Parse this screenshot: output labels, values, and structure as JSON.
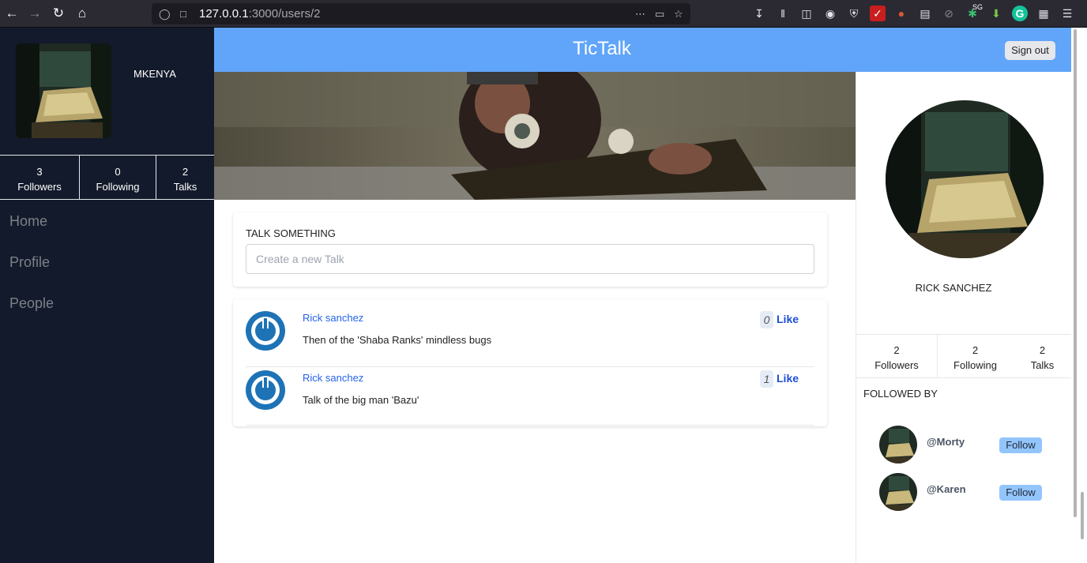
{
  "browser": {
    "url_host": "127.0.0.1",
    "url_rest": ":3000/users/2",
    "badge": "SG"
  },
  "sidebar": {
    "username": "MKENYA",
    "stats": [
      {
        "value": "3",
        "label": "Followers"
      },
      {
        "value": "0",
        "label": "Following"
      },
      {
        "value": "2",
        "label": "Talks"
      }
    ],
    "menu": [
      "Home",
      "Profile",
      "People"
    ]
  },
  "header": {
    "brand": "TicTalk",
    "signout": "Sign out"
  },
  "composer": {
    "title": "TALK SOMETHING",
    "placeholder": "Create a new Talk"
  },
  "talks": [
    {
      "author": "Rick sanchez",
      "text": "Then of the 'Shaba Ranks' mindless bugs",
      "likes": "0",
      "like_label": "Like"
    },
    {
      "author": "Rick sanchez",
      "text": "Talk of the big man 'Bazu'",
      "likes": "1",
      "like_label": "Like"
    }
  ],
  "profile": {
    "name": "RICK SANCHEZ",
    "stats": [
      {
        "value": "2",
        "label": "Followers"
      },
      {
        "value": "2",
        "label": "Following"
      },
      {
        "value": "2",
        "label": "Talks"
      }
    ],
    "followed_by_title": "FOLLOWED BY",
    "followers": [
      {
        "handle": "@Morty",
        "button": "Follow"
      },
      {
        "handle": "@Karen",
        "button": "Follow"
      }
    ]
  },
  "colors": {
    "sidebar_bg": "#131a2b",
    "header_bg": "#60a5fa",
    "link": "#2563eb",
    "follow_btn": "#93c5fd"
  }
}
